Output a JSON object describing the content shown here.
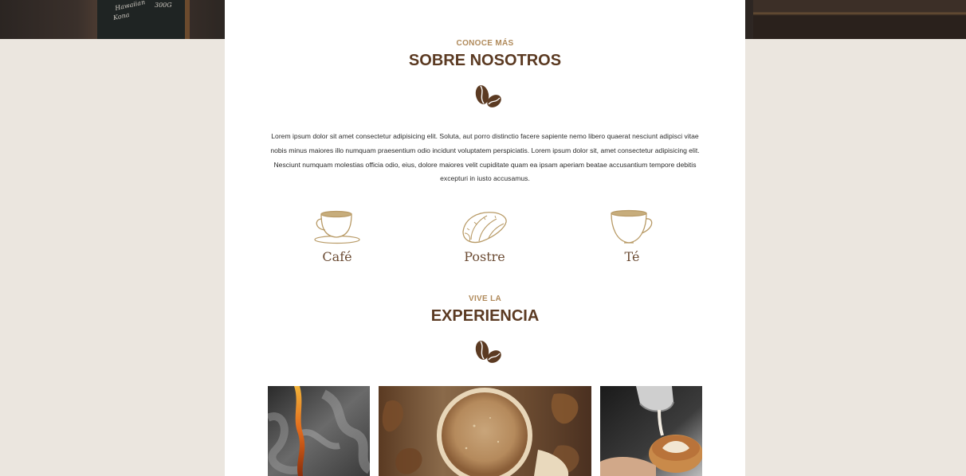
{
  "about": {
    "eyebrow": "CONOCE MÁS",
    "title": "SOBRE NOSOTROS",
    "text": "Lorem ipsum dolor sit amet consectetur adipisicing elit. Soluta, aut porro distinctio facere sapiente nemo libero quaerat nesciunt adipisci vitae nobis minus maiores illo numquam praesentium odio incidunt voluptatem perspiciatis. Lorem ipsum dolor sit, amet consectetur adipisicing elit. Nesciunt numquam molestias officia odio, eius, dolore maiores velit cupiditate quam ea ipsam aperiam beatae accusantium tempore debitis excepturi in iusto accusamus."
  },
  "features": [
    {
      "label": "Café",
      "icon": "coffee-cup-icon"
    },
    {
      "label": "Postre",
      "icon": "croissant-icon"
    },
    {
      "label": "Té",
      "icon": "tea-cup-icon"
    }
  ],
  "experience": {
    "eyebrow": "VIVE LA",
    "title": "EXPERIENCIA"
  },
  "gallery": [
    {
      "name": "fire-smoke-photo"
    },
    {
      "name": "coffee-cup-photo"
    },
    {
      "name": "latte-art-photo"
    }
  ],
  "hero": {
    "board_lines": [
      "Hawaiian",
      "Kona",
      "300G"
    ]
  },
  "colors": {
    "background": "#ebe6df",
    "title": "#5b3a22",
    "eyebrow": "#b08a5b",
    "icon_line": "#b89a66"
  }
}
